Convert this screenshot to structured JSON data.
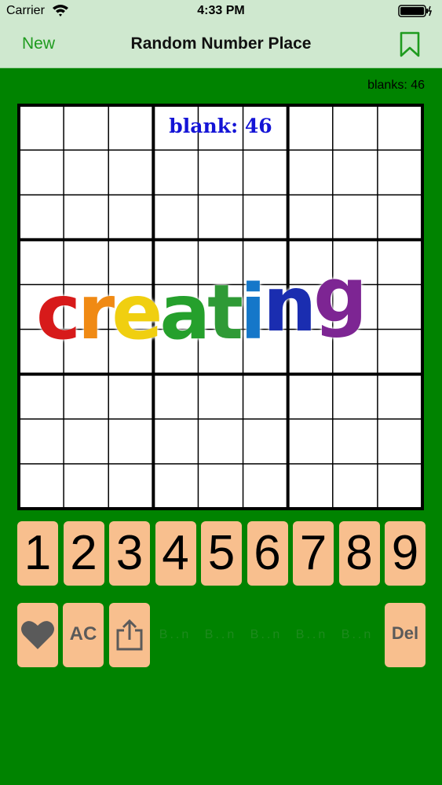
{
  "status_bar": {
    "carrier": "Carrier",
    "time": "4:33 PM"
  },
  "nav": {
    "new_label": "New",
    "title": "Random Number Place"
  },
  "board": {
    "blanks_count": "blanks: 46",
    "blank_label": "blank: 46",
    "overlay_text": "creating",
    "overlay_colors": [
      "#d71a1a",
      "#f08a14",
      "#f0cf10",
      "#25a02c",
      "#2f9a36",
      "#1577c9",
      "#1a2db0",
      "#7d2593",
      "#8a1f88"
    ]
  },
  "keypad": {
    "keys": [
      "1",
      "2",
      "3",
      "4",
      "5",
      "6",
      "7",
      "8",
      "9"
    ]
  },
  "tools": {
    "ac_label": "AC",
    "del_label": "Del",
    "ghost_slots": [
      "B..n",
      "B..n",
      "B..n",
      "B..n",
      "B..n"
    ]
  },
  "colors": {
    "background": "#008300",
    "navbar": "#cfe8cf",
    "key": "#f8bf8e",
    "accent": "#1f9b1f"
  },
  "icons": {
    "favorite": "heart-icon",
    "share": "share-icon",
    "bookmark": "bookmark-icon"
  }
}
